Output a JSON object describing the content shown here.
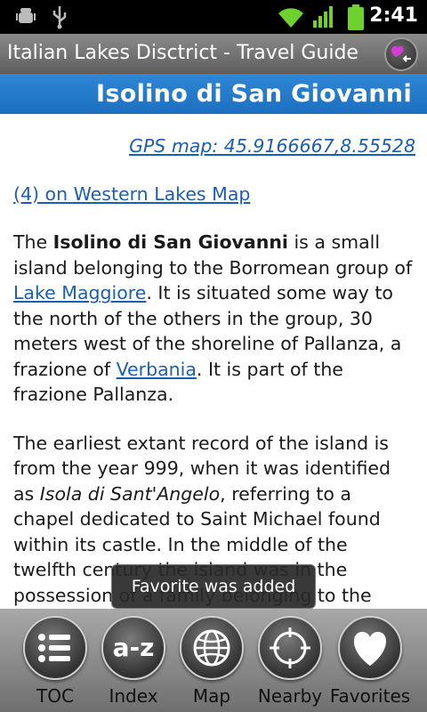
{
  "status_bar": {
    "time": "2:41",
    "icons": [
      "android-debug-icon",
      "usb-icon",
      "wifi-icon",
      "signal-icon",
      "battery-icon"
    ]
  },
  "app": {
    "title": "Italian Lakes Disctrict - Travel Guide"
  },
  "page": {
    "heading": "Isolino di San Giovanni",
    "gps_link": "GPS map: 45.9166667,8.55528",
    "map_link": "(4) on Western Lakes Map",
    "p1": {
      "t1": "The ",
      "b1": "Isolino di San Giovanni",
      "t2": " is a small island belonging to the Borromean group of ",
      "link1": "Lake Maggiore",
      "t3": ". It is situated some way to the north of the others in the group, 30 meters west of the shoreline of Pallanza, a frazione of ",
      "link2": "Verbania",
      "t4": ". It is part of the frazione Pallanza."
    },
    "p2": {
      "t1": "The earliest extant record of the island is from the year 999, when it was identified as ",
      "i1": "Isola di Sant'Angelo",
      "t2": ", referring to a chapel dedicated to Saint Michael found within its castle. In the middle of the twelfth century the island was in the possession of a family belonging to the"
    }
  },
  "toast": "Favorite was added",
  "toolbar": {
    "items": [
      {
        "label": "TOC",
        "icon": "list-icon"
      },
      {
        "label": "Index",
        "icon": "az-icon",
        "glyph": "a-z"
      },
      {
        "label": "Map",
        "icon": "globe-icon"
      },
      {
        "label": "Nearby",
        "icon": "crosshair-icon"
      },
      {
        "label": "Favorites",
        "icon": "heart-icon"
      }
    ]
  },
  "colors": {
    "heading_bg": "#1c6fc0",
    "link": "#1a5fb4",
    "title_bar": "#6e6e6e"
  }
}
